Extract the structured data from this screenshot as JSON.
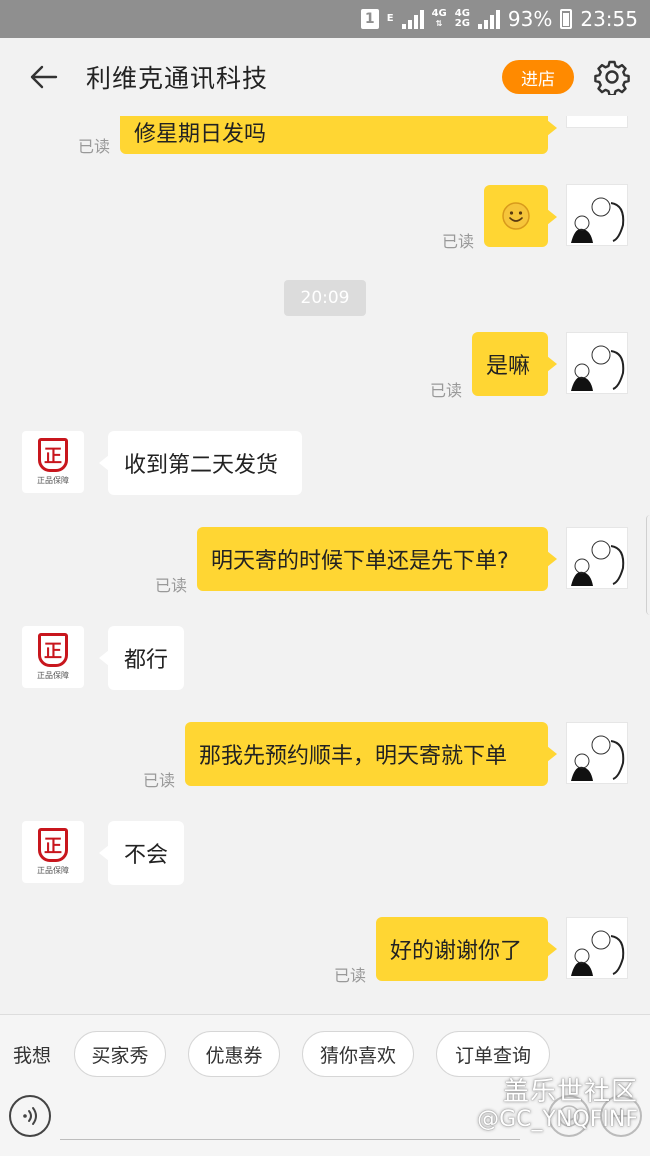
{
  "status_bar": {
    "badge": "1",
    "network_e": "E",
    "net1": "4G",
    "net2": "4G",
    "net3": "2G",
    "battery": "93%",
    "time": "23:55"
  },
  "header": {
    "title": "利维克通讯科技",
    "shop_button": "进店"
  },
  "chat": {
    "partial_message": {
      "text": "修星期日发吗",
      "read": "已读"
    },
    "messages": [
      {
        "from": "me",
        "type": "emoji",
        "icon": "smiley-emoji",
        "read": "已读"
      },
      {
        "from": "me",
        "text": "是嘛",
        "read": "已读"
      },
      {
        "from": "seller",
        "text": "收到第二天发货"
      },
      {
        "from": "me",
        "text": "明天寄的时候下单还是先下单?",
        "read": "已读"
      },
      {
        "from": "seller",
        "text": "都行"
      },
      {
        "from": "me",
        "text": "那我先预约顺丰，明天寄就下单",
        "read": "已读"
      },
      {
        "from": "seller",
        "text": "不会"
      },
      {
        "from": "me",
        "text": "好的谢谢你了",
        "read": "已读"
      }
    ],
    "time_divider": "20:09",
    "seller_badge": {
      "char": "正",
      "caption1": "正品保障",
      "caption2": "正品保障",
      "caption3": "正品保障"
    }
  },
  "bottom": {
    "quick_label": "我想",
    "chips": [
      "买家秀",
      "优惠券",
      "猜你喜欢",
      "订单查询"
    ],
    "watermark_line1": "盖乐世社区",
    "watermark_line2": "@GC_YNQFINF"
  },
  "colors": {
    "accent": "#ff8a00",
    "my_bubble": "#ffd633",
    "seller_bubble": "#ffffff",
    "status_bar": "#8f8f8f"
  }
}
